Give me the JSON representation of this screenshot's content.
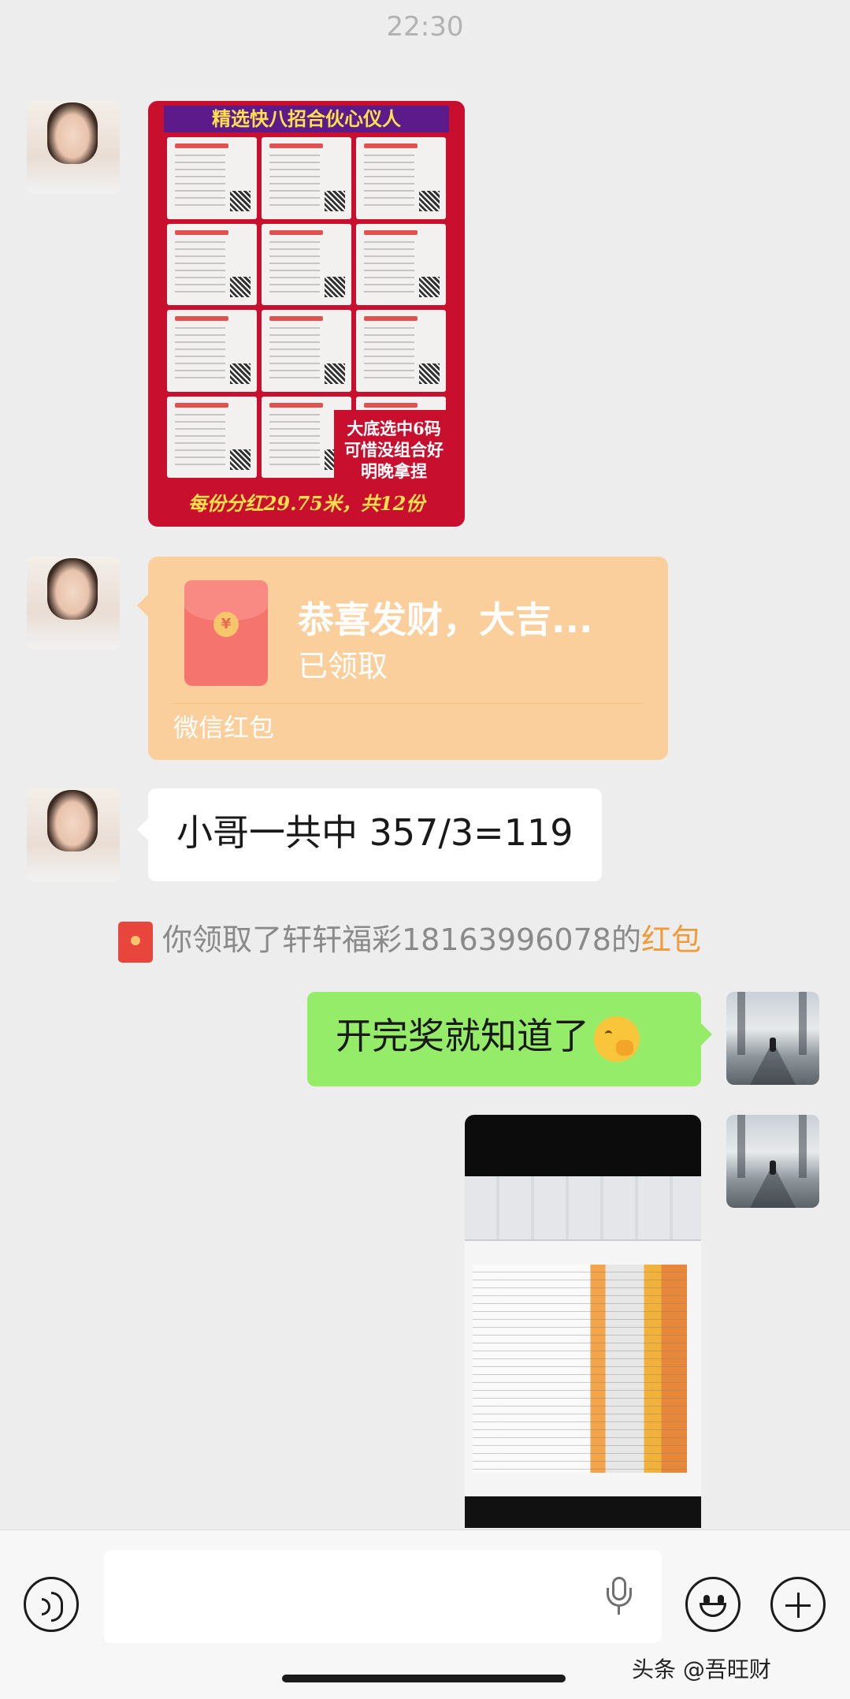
{
  "status": {
    "time": "22:30"
  },
  "messages": {
    "poster": {
      "header": "精选快八招合伙心仪人",
      "note_lines": [
        "大底选中6码",
        "可惜没组合好",
        "明晚拿捏"
      ],
      "footer": "每份分红29.75米，共12份"
    },
    "red_packet": {
      "title": "恭喜发财，大吉...",
      "status": "已领取",
      "label": "微信红包"
    },
    "text_left": "小哥一共中 357/3=119",
    "system_notice": {
      "prefix": "你领取了轩轩福彩18163996078的",
      "link": "红包"
    },
    "text_right": "开完奖就知道了"
  },
  "input_bar": {
    "placeholder": ""
  },
  "watermark": "头条 @吾旺财",
  "icons": {
    "voice": "voice-icon",
    "mic": "mic-icon",
    "emoji": "emoji-icon",
    "plus": "plus-icon",
    "red_packet": "red-packet-icon"
  },
  "colors": {
    "background": "#ededed",
    "bubble_self": "#95ec69",
    "bubble_other": "#ffffff",
    "red_packet": "#fbcf9c",
    "link": "#f19a38"
  }
}
